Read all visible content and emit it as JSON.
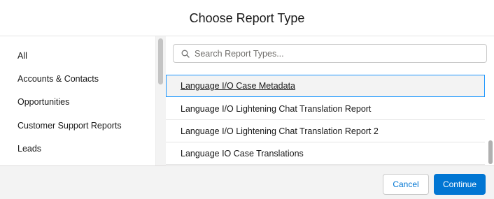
{
  "modal": {
    "title": "Choose Report Type"
  },
  "sidebar": {
    "items": [
      {
        "label": "All"
      },
      {
        "label": "Accounts & Contacts"
      },
      {
        "label": "Opportunities"
      },
      {
        "label": "Customer Support Reports"
      },
      {
        "label": "Leads"
      }
    ]
  },
  "search": {
    "placeholder": "Search Report Types...",
    "value": ""
  },
  "report_types": [
    {
      "label": "Language I/O Case Metadata",
      "selected": true
    },
    {
      "label": "Language I/O Lightening Chat Translation Report",
      "selected": false
    },
    {
      "label": "Language I/O Lightening Chat Translation Report 2",
      "selected": false
    },
    {
      "label": "Language IO Case Translations",
      "selected": false
    }
  ],
  "footer": {
    "cancel_label": "Cancel",
    "continue_label": "Continue"
  },
  "colors": {
    "accent": "#0176d3",
    "selection_border": "#1b96ff",
    "footer_bg": "#f3f3f3"
  },
  "icons": {
    "search": "search-icon"
  }
}
